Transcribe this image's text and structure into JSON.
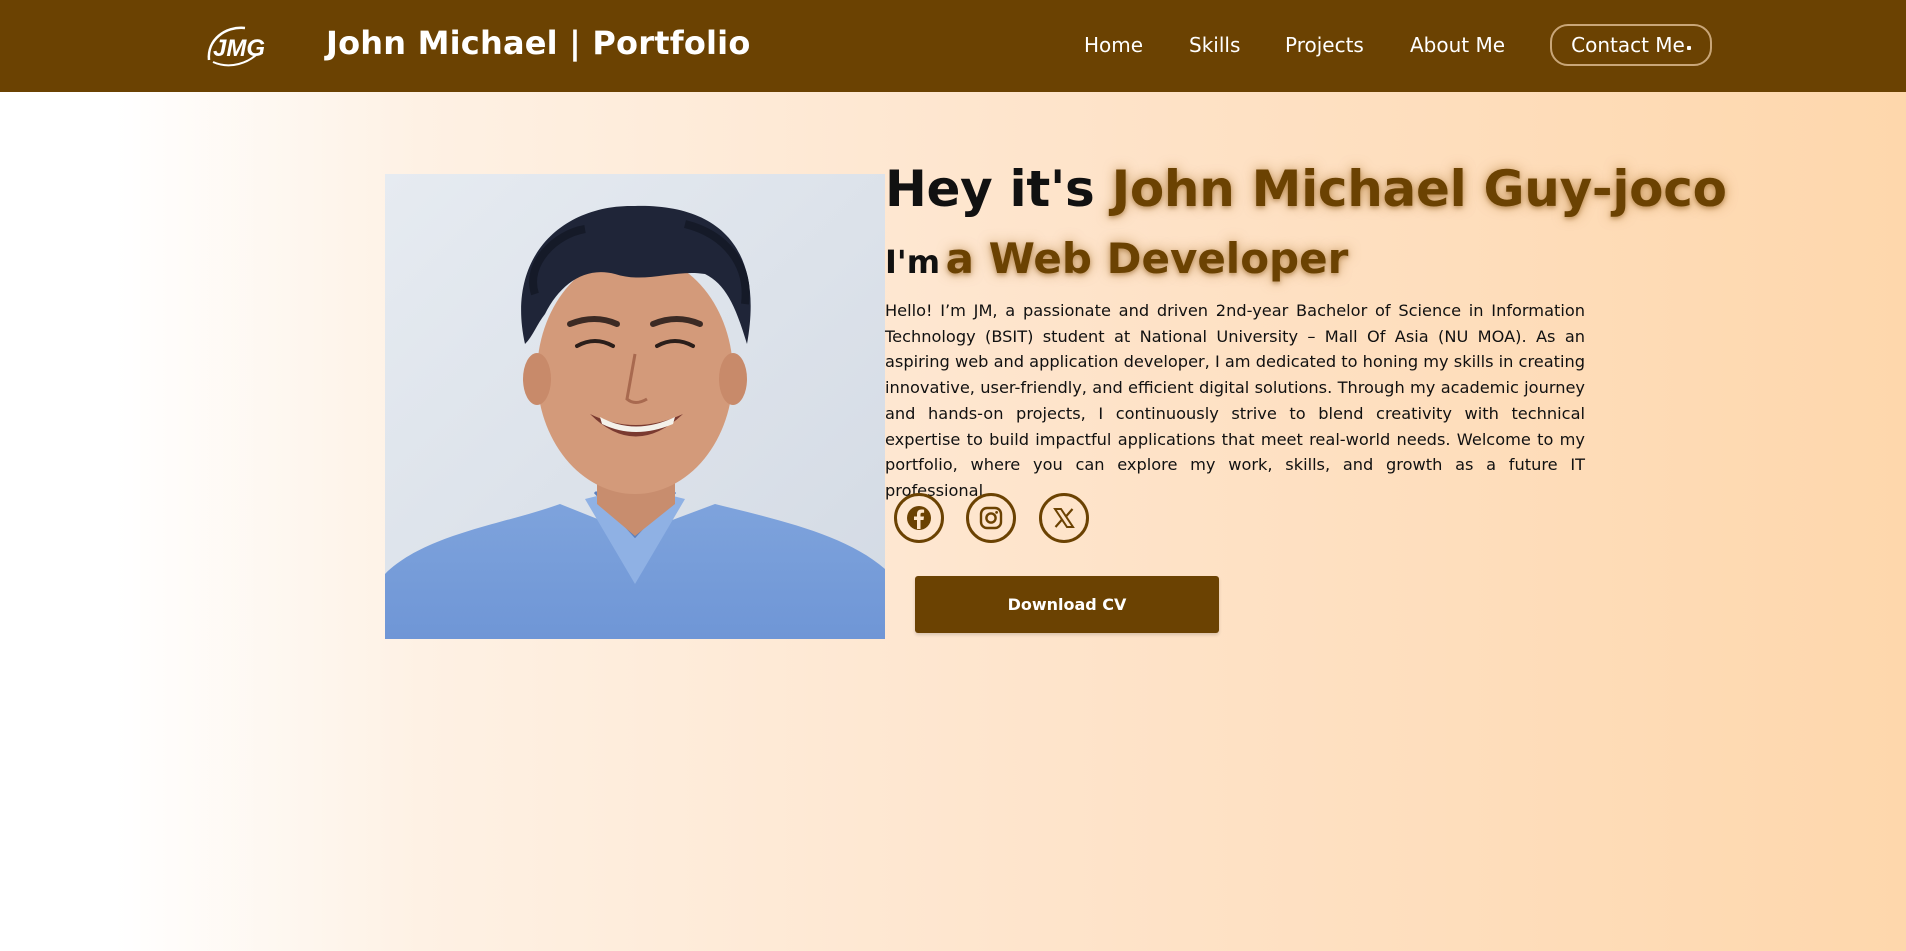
{
  "header": {
    "logo_text": "JMG",
    "brand": "John Michael | Portfolio",
    "nav": [
      {
        "label": "Home"
      },
      {
        "label": "Skills"
      },
      {
        "label": "Projects"
      },
      {
        "label": "About Me"
      }
    ],
    "contact_label": "Contact Me"
  },
  "hero": {
    "greeting_prefix": "Hey it's",
    "name": "John Michael Guy-joco",
    "role_prefix": "I'm",
    "role": "a Web Developer",
    "bio": "Hello! I’m JM, a passionate and driven 2nd-year Bachelor of Science in Information Technology (BSIT) student at National University – Mall Of Asia (NU MOA). As an aspiring web and application developer, I am dedicated to honing my skills in creating innovative, user-friendly, and efficient digital solutions. Through my academic journey and hands-on projects, I continuously strive to blend creativity with technical expertise to build impactful applications that meet real-world needs. Welcome to my portfolio, where you can explore my work, skills, and growth as a future IT professional.",
    "social": [
      {
        "icon": "facebook-icon"
      },
      {
        "icon": "instagram-icon"
      },
      {
        "icon": "x-twitter-icon"
      }
    ],
    "download_label": "Download CV"
  },
  "colors": {
    "brand_brown": "#6b4202",
    "peach": "#fed7ac"
  }
}
